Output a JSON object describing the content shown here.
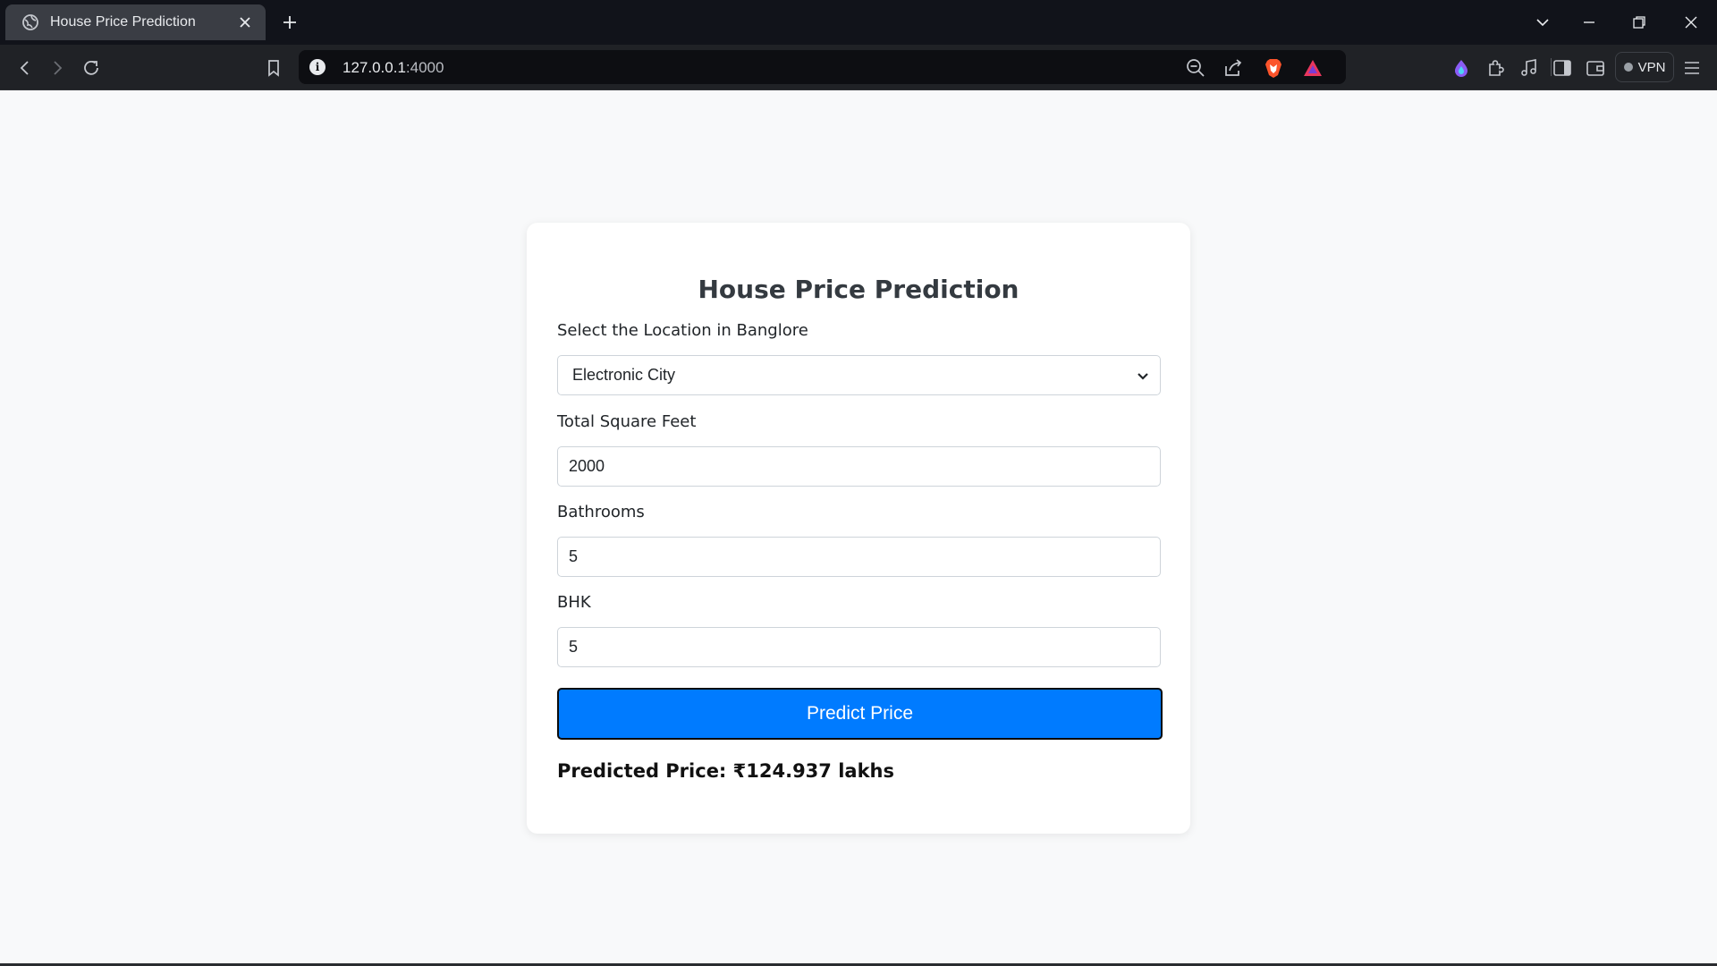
{
  "browser": {
    "tab_title": "House Price Prediction",
    "url_host": "127.0.0.1",
    "url_port": ":4000",
    "vpn_label": "VPN",
    "icons": [
      "globe-icon",
      "close-icon",
      "plus-icon",
      "chevron-down-icon",
      "minimize-icon",
      "restore-icon",
      "window-close-icon",
      "back-icon",
      "forward-icon",
      "reload-icon",
      "bookmark-icon",
      "info-icon",
      "zoom-out-icon",
      "share-icon",
      "brave-shield-icon",
      "brave-rewards-icon",
      "leo-ai-icon",
      "extensions-icon",
      "media-icon",
      "sidebar-icon",
      "wallet-icon",
      "menu-icon"
    ]
  },
  "form": {
    "title": "House Price Prediction",
    "location_label": "Select the Location in Banglore",
    "location_value": "Electronic City",
    "sqft_label": "Total Square Feet",
    "sqft_value": "2000",
    "bath_label": "Bathrooms",
    "bath_value": "5",
    "bhk_label": "BHK",
    "bhk_value": "5",
    "button_label": "Predict Price",
    "result_text": "Predicted Price: ₹124.937 lakhs"
  },
  "colors": {
    "accent": "#007bff",
    "page_bg": "#f8f9fa",
    "chrome_bg": "#11131a"
  }
}
